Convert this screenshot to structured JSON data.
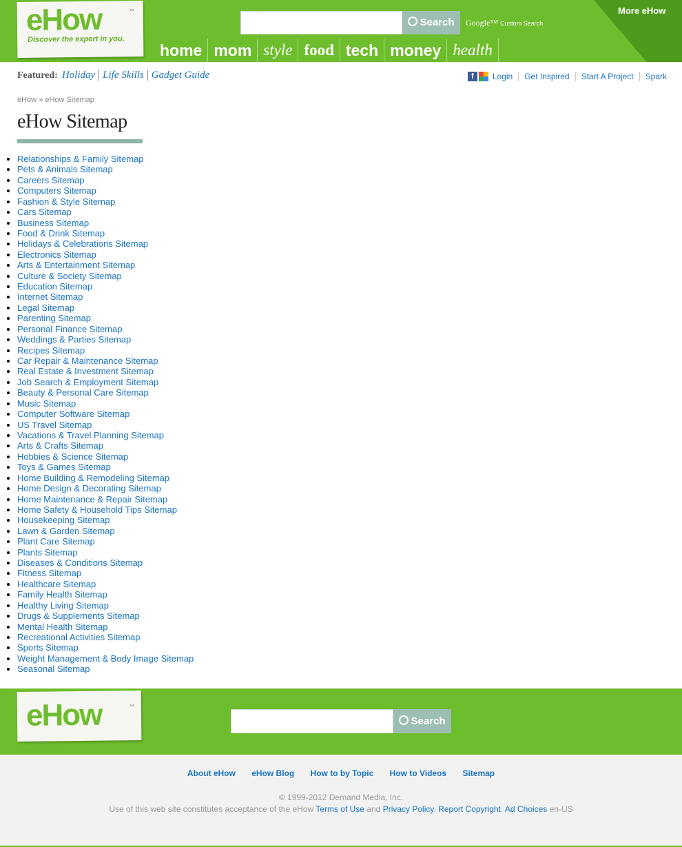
{
  "header": {
    "logo_text": "eHow",
    "logo_tagline": "Discover the expert in you.",
    "search_button": "Search",
    "powered_by": "Google™",
    "powered_by_sub": "Custom Search",
    "more_label": "More eHow",
    "nav": [
      "home",
      "mom",
      "style",
      "food",
      "tech",
      "money",
      "health"
    ]
  },
  "featured": {
    "label": "Featured:",
    "links": [
      "Holiday",
      "Life Skills",
      "Gadget Guide"
    ]
  },
  "userbar": {
    "login": "Login",
    "links": [
      "Get Inspired",
      "Start A Project",
      "Spark"
    ]
  },
  "breadcrumb": {
    "home": "eHow",
    "separator": "»",
    "current": "eHow Sitemap"
  },
  "page": {
    "title": "eHow Sitemap"
  },
  "sitemap_links": [
    "Relationships & Family Sitemap",
    "Pets & Animals Sitemap",
    "Careers Sitemap",
    "Computers Sitemap",
    "Fashion & Style Sitemap",
    "Cars Sitemap",
    "Business Sitemap",
    "Food & Drink Sitemap",
    "Holidays & Celebrations Sitemap",
    "Electronics Sitemap",
    "Arts & Entertainment Sitemap",
    "Culture & Society Sitemap",
    "Education Sitemap",
    "Internet Sitemap",
    "Legal Sitemap",
    "Parenting Sitemap",
    "Personal Finance Sitemap",
    "Weddings & Parties Sitemap",
    "Recipes Sitemap",
    "Car Repair & Maintenance Sitemap",
    "Real Estate & Investment Sitemap",
    "Job Search & Employment Sitemap",
    "Beauty & Personal Care Sitemap",
    "Music Sitemap",
    "Computer Software Sitemap",
    "US Travel Sitemap",
    "Vacations & Travel Planning Sitemap",
    "Arts & Crafts Sitemap",
    "Hobbies & Science Sitemap",
    "Toys & Games Sitemap",
    "Home Building & Remodeling Sitemap",
    "Home Design & Decorating Sitemap",
    "Home Maintenance & Repair Sitemap",
    "Home Safety & Household Tips Sitemap",
    "Housekeeping Sitemap",
    "Lawn & Garden Sitemap",
    "Plant Care Sitemap",
    "Plants Sitemap",
    "Diseases & Conditions Sitemap",
    "Fitness Sitemap",
    "Healthcare Sitemap",
    "Family Health Sitemap",
    "Healthy Living Sitemap",
    "Drugs & Supplements Sitemap",
    "Mental Health Sitemap",
    "Recreational Activities Sitemap",
    "Sports Sitemap",
    "Weight Management & Body Image Sitemap",
    "Seasonal Sitemap"
  ],
  "footer": {
    "search_button": "Search",
    "links": [
      "About eHow",
      "eHow Blog",
      "How to by Topic",
      "How to Videos",
      "Sitemap"
    ],
    "copyright": "© 1999-2012 Demand Media, Inc.",
    "legal_prefix": "Use of this web site constitutes acceptance of the eHow",
    "terms": "Terms of Use",
    "and": "and",
    "privacy": "Privacy Policy",
    "report": "Report Copyright",
    "adchoices": "Ad Choices",
    "locale": "en-US"
  },
  "colors": {
    "brand_green": "#6dbd2c",
    "link_blue": "#1a73c5",
    "button_teal": "#9dbfb3"
  }
}
